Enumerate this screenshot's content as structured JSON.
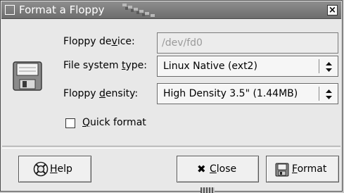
{
  "window": {
    "title": "Format a Floppy",
    "close_glyph": "×"
  },
  "form": {
    "floppy_device": {
      "label_pre": "Floppy de",
      "label_key": "v",
      "label_post": "ice:",
      "value": "/dev/fd0"
    },
    "file_system_type": {
      "label_pre": "File system ",
      "label_key": "t",
      "label_post": "ype:",
      "value": "Linux Native (ext2)"
    },
    "floppy_density": {
      "label_pre": "Floppy ",
      "label_key": "d",
      "label_post": "ensity:",
      "value": "High Density 3.5\" (1.44MB)"
    },
    "quick_format": {
      "label_key": "Q",
      "label_post": "uick format",
      "checked": false
    }
  },
  "buttons": {
    "help": {
      "key": "H",
      "rest": "elp",
      "icon": "help-lifebuoy-icon"
    },
    "close": {
      "key": "C",
      "rest": "lose",
      "glyph": "✖",
      "icon": "close-x-icon"
    },
    "format": {
      "key": "F",
      "rest": "ormat",
      "icon": "floppy-save-icon"
    }
  },
  "colors": {
    "titlebar": "#7a7a7a",
    "window_bg": "#e8e8e8",
    "field_disabled_bg": "#ececec"
  }
}
